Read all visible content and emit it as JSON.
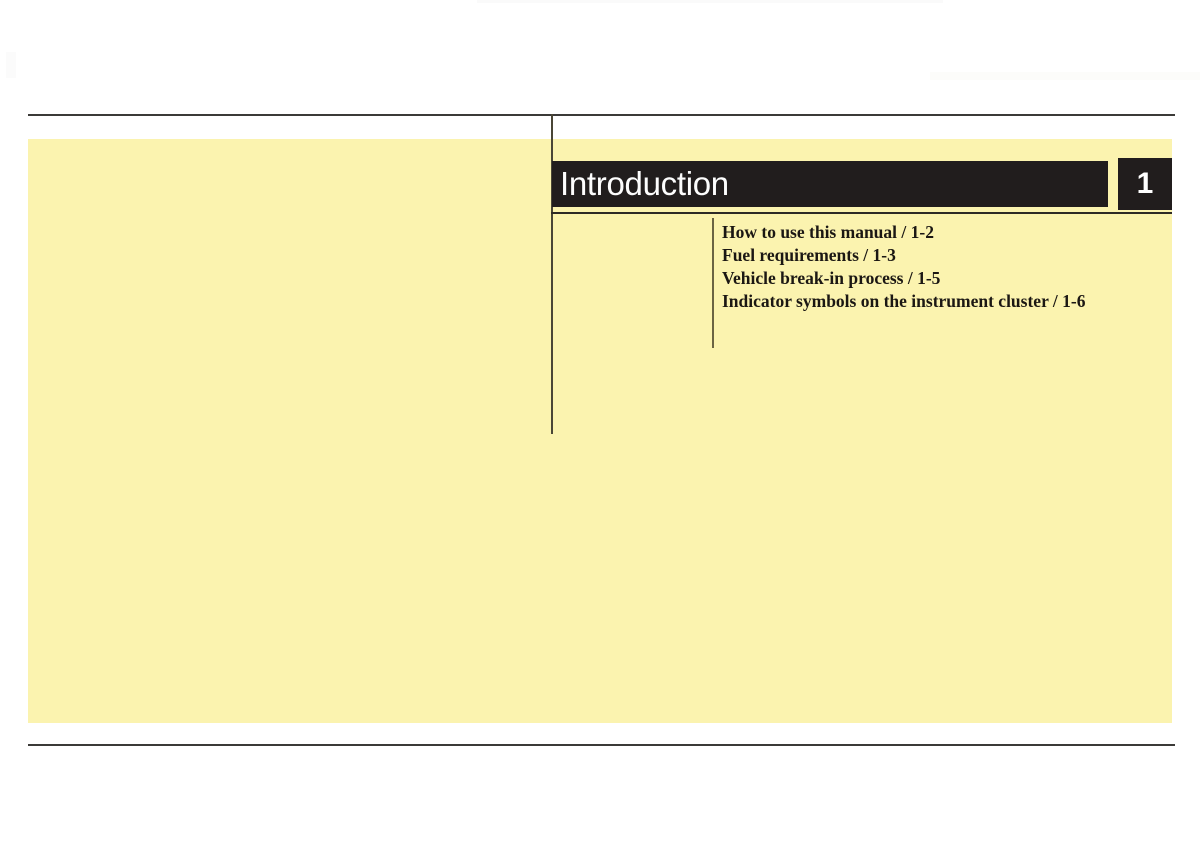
{
  "page": {
    "background_color": "#ffffff",
    "panel_color": "#fbf3af",
    "rule_color": "#3b3a38",
    "header_color": "#211d1d",
    "header_text_color": "#fdfdfd",
    "body_text_color": "#1b1713"
  },
  "chapter": {
    "title": "Introduction",
    "number": "1"
  },
  "toc": {
    "items": [
      {
        "label": "How to use this manual / 1-2"
      },
      {
        "label": "Fuel requirements / 1-3"
      },
      {
        "label": "Vehicle break-in process / 1-5"
      },
      {
        "label": "Indicator symbols on the instrument cluster / 1-6"
      }
    ]
  }
}
